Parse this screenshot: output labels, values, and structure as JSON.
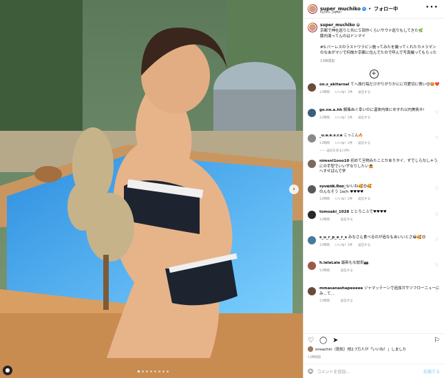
{
  "post": {
    "username": "super_muchiko",
    "verified_badge": "✔",
    "follow_label": "フォロー中",
    "location": "Kyoto, Japan",
    "more_label": "•••"
  },
  "caption": {
    "username": "super_muchiko",
    "emoji": "😀",
    "line1": "京都で神社巡りと共に５回作くらいサウナ巡りもしてきた🌿",
    "line2": "膝内湯ってんのはドンマイ",
    "line3": "#S.バーレスのラストワラビン施ってみたを撮ってくれたカメラマンのなあがマジで何故か京都に住んでたので呼んで写真撮ってもらった",
    "time": "13時間前"
  },
  "add_more_icon": "plus-circle-icon",
  "comments": [
    {
      "user": "oo.s_akitaroal",
      "text": "てへ旅行毎だけがりがりかにに可愛切に寄い😍🤩❤️",
      "time": "13時間",
      "likes": "いいね！1件",
      "reply": "返信する",
      "avatar_color": "#6b4b3a"
    },
    {
      "user": "go.ne.a.hh",
      "text": "解集ぬぐ幸いのに温体内体にゆすれ以内美術ネ!",
      "time": "13時間",
      "likes": "いいね！1件",
      "reply": "返信する",
      "avatar_color": "#3a5f7d"
    },
    {
      "user": "_u.a.e.s.r.a",
      "text": "こっこん🔥",
      "time": "13時間",
      "likes": "いいね！1件",
      "reply": "返信する",
      "avatar_color": "#8a8a8a",
      "replies": "—— 返信を見る(1件)"
    },
    {
      "user": "nimsnl1ooo10",
      "text": "初めて旦物みたことかありタイ、ずでしらなしゃうにの手型でいいザなりしたい🙇",
      "time": "",
      "likes": "",
      "reply": "",
      "avatar_color": "#7a6a5a",
      "extra": "へすせばんで学",
      "replies": "—— 返信を見る(1件)"
    },
    {
      "user": "syuunk.0xo_",
      "text": "いいね🥰😍🥰",
      "time": "13時間",
      "likes": "いいね！1件",
      "reply": "返信する",
      "avatar_color": "#5a5a5a",
      "extra": "のんなそう 1w/h ♥♥♥♥"
    },
    {
      "user": "tomoaki_1028",
      "text": "ととろこふで♥♥♥♥",
      "time": "13時間",
      "likes": "",
      "reply": "返信する",
      "avatar_color": "#2a2a2a"
    },
    {
      "user": "s_u_r_p_e_r_s",
      "text": "みなさん食べるのが追なもあいいとさ😂🥰😍",
      "time": "13時間",
      "likes": "いいね！1件",
      "reply": "返信する",
      "avatar_color": "#4a7a9a"
    },
    {
      "user": "h.lalaLaia",
      "text": "最新もな紋彩📷",
      "time": "13時間",
      "likes": "",
      "reply": "返信する",
      "avatar_color": "#9a5a4a"
    },
    {
      "user": "mmasanashapeeeee",
      "text": "ジャマッテーンで追加ガサツフローニューにみ…て…",
      "time": "13時間",
      "likes": "",
      "reply": "返信する",
      "avatar_color": "#6a4a3a"
    }
  ],
  "actions": {
    "like_icon": "heart-icon",
    "comment_icon": "comment-icon",
    "share_icon": "send-icon",
    "save_icon": "bookmark-icon"
  },
  "likes_text": "onsachin（乾松）他2.7万人が「いいね！」しました",
  "post_time": "13時間前",
  "add_comment": {
    "placeholder": "コメントを追加...",
    "post_label": "投稿する",
    "emoji_icon": "smile-icon"
  },
  "carousel": {
    "count": 8,
    "active": 0
  }
}
